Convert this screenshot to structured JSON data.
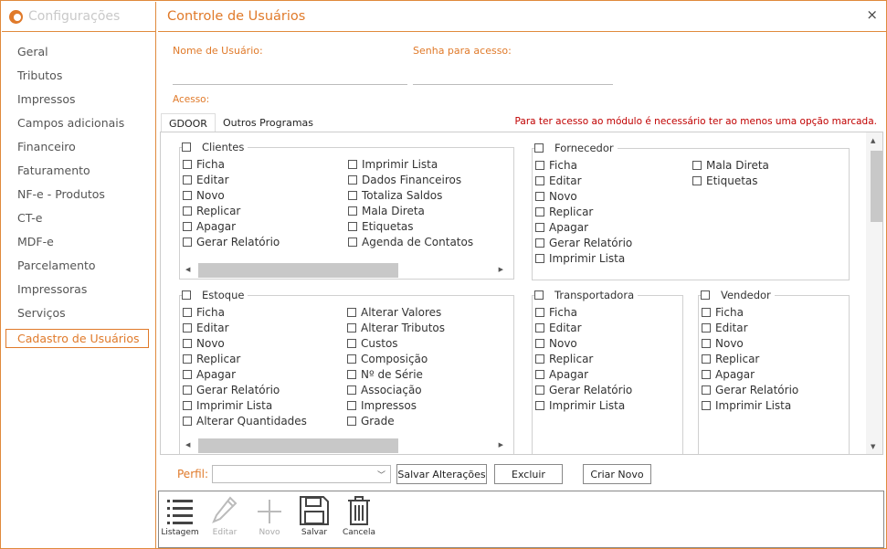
{
  "sidebar": {
    "title": "Configurações",
    "items": [
      "Geral",
      "Tributos",
      "Impressos",
      "Campos adicionais",
      "Financeiro",
      "Faturamento",
      "NF-e - Produtos",
      "CT-e",
      "MDF-e",
      "Parcelamento",
      "Impressoras",
      "Serviços",
      "Cadastro de Usuários"
    ],
    "active_index": 12
  },
  "window": {
    "title": "Controle de Usuários",
    "close": "×"
  },
  "form": {
    "username_label": "Nome de Usuário:",
    "username_value": "",
    "password_label": "Senha para acesso:",
    "password_value": "",
    "access_label": "Acesso:"
  },
  "tabs": [
    "GDOOR",
    "Outros Programas"
  ],
  "warning": "Para ter acesso ao módulo é necessário ter ao menos uma opção marcada.",
  "groups": {
    "clientes": {
      "title": "Clientes",
      "col1": [
        "Ficha",
        "Editar",
        "Novo",
        "Replicar",
        "Apagar",
        "Gerar Relatório"
      ],
      "col2": [
        "Imprimir Lista",
        "Dados Financeiros",
        "Totaliza Saldos",
        "Mala Direta",
        "Etiquetas",
        "Agenda de Contatos"
      ]
    },
    "fornecedor": {
      "title": "Fornecedor",
      "col1": [
        "Ficha",
        "Editar",
        "Novo",
        "Replicar",
        "Apagar",
        "Gerar Relatório",
        "Imprimir Lista"
      ],
      "col2": [
        "Mala Direta",
        "Etiquetas"
      ]
    },
    "estoque": {
      "title": "Estoque",
      "col1": [
        "Ficha",
        "Editar",
        "Novo",
        "Replicar",
        "Apagar",
        "Gerar Relatório",
        "Imprimir Lista",
        "Alterar Quantidades"
      ],
      "col2": [
        "Alterar Valores",
        "Alterar Tributos",
        "Custos",
        "Composição",
        "Nº de Série",
        "Associação",
        "Impressos",
        "Grade"
      ]
    },
    "transportadora": {
      "title": "Transportadora",
      "col1": [
        "Ficha",
        "Editar",
        "Novo",
        "Replicar",
        "Apagar",
        "Gerar Relatório",
        "Imprimir Lista"
      ]
    },
    "vendedor": {
      "title": "Vendedor",
      "col1": [
        "Ficha",
        "Editar",
        "Novo",
        "Replicar",
        "Apagar",
        "Gerar Relatório",
        "Imprimir Lista"
      ]
    }
  },
  "perfil": {
    "label": "Perfil:",
    "value": ""
  },
  "buttons": {
    "save_changes": "Salvar Alterações",
    "delete": "Excluir",
    "create_new": "Criar Novo"
  },
  "toolbar": {
    "list": "Listagem",
    "edit": "Editar",
    "new": "Novo",
    "save": "Salvar",
    "cancel": "Cancela"
  },
  "colors": {
    "accent": "#e07a2a",
    "warning": "#c00000"
  }
}
